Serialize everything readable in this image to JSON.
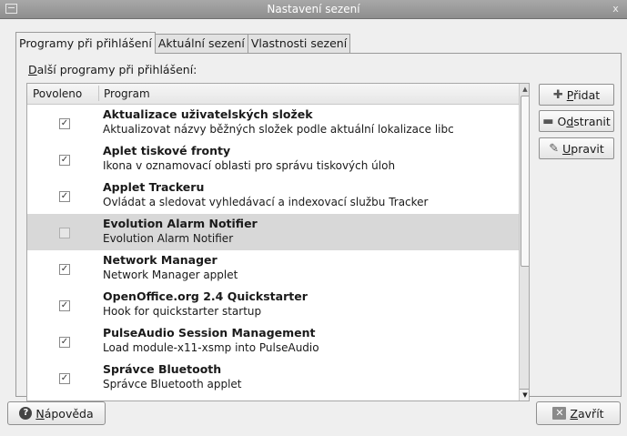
{
  "window": {
    "title": "Nastavení sezení",
    "close_glyph": "x"
  },
  "tabs": [
    {
      "label": "Programy při přihlášení",
      "active": true
    },
    {
      "label": "Aktuální sezení",
      "active": false
    },
    {
      "label": "Vlastnosti sezení",
      "active": false
    }
  ],
  "section": {
    "label_mnemonic": "D",
    "label_rest": "alší programy při přihlášení:"
  },
  "table": {
    "headers": {
      "enabled": "Povoleno",
      "program": "Program"
    },
    "rows": [
      {
        "enabled": true,
        "name": "Aktualizace uživatelských složek",
        "desc": "Aktualizovat názvy běžných složek podle aktuální lokalizace libc"
      },
      {
        "enabled": true,
        "name": "Aplet tiskové fronty",
        "desc": "Ikona v oznamovací oblasti pro správu tiskových úloh"
      },
      {
        "enabled": true,
        "name": "Applet Trackeru",
        "desc": "Ovládat a sledovat vyhledávací a indexovací službu Tracker"
      },
      {
        "enabled": false,
        "name": "Evolution Alarm Notifier",
        "desc": "Evolution Alarm Notifier",
        "selected": true
      },
      {
        "enabled": true,
        "name": "Network Manager",
        "desc": "Network Manager applet"
      },
      {
        "enabled": true,
        "name": "OpenOffice.org 2.4 Quickstarter",
        "desc": "Hook for quickstarter startup"
      },
      {
        "enabled": true,
        "name": "PulseAudio Session Management",
        "desc": "Load module-x11-xsmp into PulseAudio"
      },
      {
        "enabled": true,
        "name": "Správce Bluetooth",
        "desc": "Správce Bluetooth applet"
      }
    ]
  },
  "buttons": {
    "add": {
      "mnemonic": "P",
      "rest": "řidat"
    },
    "remove": {
      "pre": "O",
      "mnemonic": "d",
      "rest": "stranit"
    },
    "edit": {
      "mnemonic": "U",
      "rest": "pravit"
    },
    "help": {
      "mnemonic": "N",
      "rest": "ápověda"
    },
    "close": {
      "mnemonic": "Z",
      "rest": "avřít"
    }
  },
  "icons": {
    "add": "plus-icon",
    "remove": "minus-icon",
    "edit": "edit-icon",
    "help": "help-icon",
    "close": "close-icon",
    "check": "checkmark-icon"
  }
}
